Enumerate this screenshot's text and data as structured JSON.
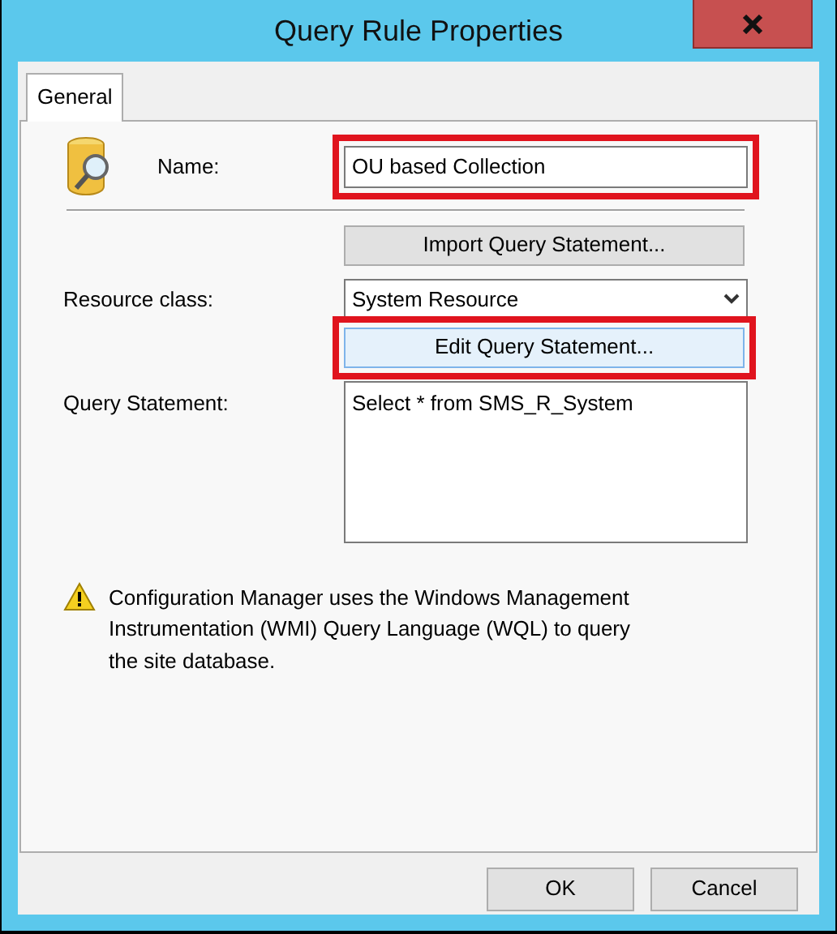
{
  "window": {
    "title": "Query Rule Properties"
  },
  "tabs": [
    {
      "label": "General",
      "selected": true
    }
  ],
  "name_field": {
    "label": "Name:",
    "value": "OU based Collection",
    "highlighted": true
  },
  "import_button": {
    "label": "Import Query Statement...",
    "highlighted": false
  },
  "resource_class": {
    "label": "Resource class:",
    "value": "System Resource"
  },
  "edit_button": {
    "label": "Edit Query Statement...",
    "highlighted": true
  },
  "query_statement": {
    "label": "Query Statement:",
    "value": "Select * from SMS_R_System"
  },
  "warning": "Configuration Manager uses the Windows Management Instrumentation (WMI) Query Language (WQL) to query the site database.",
  "buttons": [
    "OK",
    "Cancel"
  ]
}
